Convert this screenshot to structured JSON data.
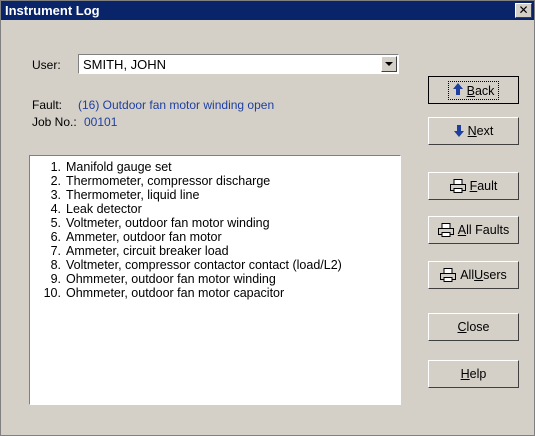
{
  "window": {
    "title": "Instrument Log"
  },
  "user": {
    "label": "User:",
    "value": "SMITH, JOHN"
  },
  "fault": {
    "label": "Fault:",
    "value": "(16)  Outdoor fan motor winding open"
  },
  "job": {
    "label": "Job No.:",
    "value": "00101"
  },
  "instruments": [
    {
      "num": "1.",
      "text": "Manifold gauge set"
    },
    {
      "num": "2.",
      "text": "Thermometer, compressor discharge"
    },
    {
      "num": "3.",
      "text": "Thermometer, liquid line"
    },
    {
      "num": "4.",
      "text": "Leak detector"
    },
    {
      "num": "5.",
      "text": "Voltmeter, outdoor fan motor winding"
    },
    {
      "num": "6.",
      "text": "Ammeter, outdoor fan motor"
    },
    {
      "num": "7.",
      "text": "Ammeter, circuit breaker load"
    },
    {
      "num": "8.",
      "text": "Voltmeter, compressor contactor contact (load/L2)"
    },
    {
      "num": "9.",
      "text": "Ohmmeter, outdoor fan motor winding"
    },
    {
      "num": "10.",
      "text": "Ohmmeter, outdoor fan motor capacitor"
    }
  ],
  "buttons": {
    "back": {
      "pre": "",
      "accel": "B",
      "post": "ack",
      "icon": "up-arrow-icon"
    },
    "next": {
      "pre": "",
      "accel": "N",
      "post": "ext",
      "icon": "down-arrow-icon"
    },
    "fault": {
      "pre": "",
      "accel": "F",
      "post": "ault",
      "icon": "printer-icon"
    },
    "all_faults": {
      "pre": "",
      "accel": "A",
      "post": "ll Faults",
      "icon": "printer-icon"
    },
    "all_users": {
      "pre": "All ",
      "accel": "U",
      "post": "sers",
      "icon": "printer-icon"
    },
    "close": {
      "pre": "",
      "accel": "C",
      "post": "lose"
    },
    "help": {
      "pre": "",
      "accel": "H",
      "post": "elp"
    }
  },
  "colors": {
    "title_bar": "#0a246a",
    "value_text": "#1f3fa0",
    "face": "#d4d0c8"
  }
}
